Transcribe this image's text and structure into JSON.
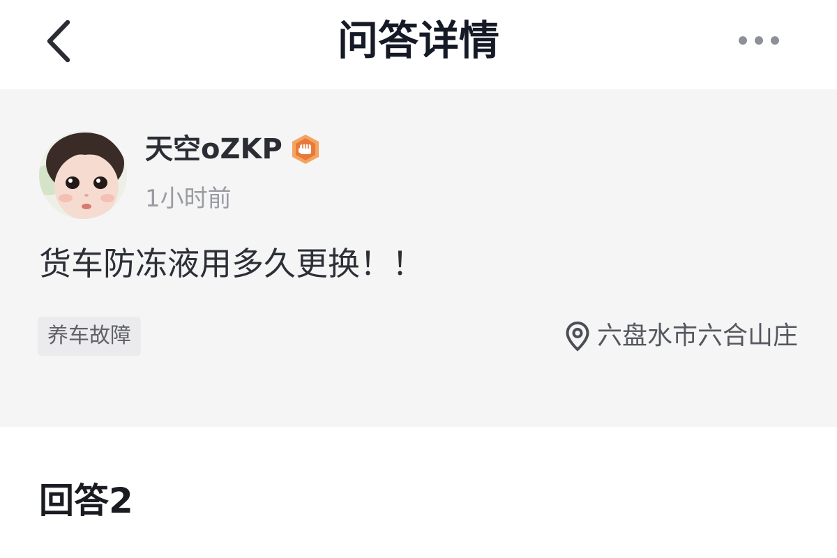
{
  "header": {
    "title": "问答详情",
    "back_icon": "chevron-left-icon",
    "more_icon": "more-horizontal-icon"
  },
  "question": {
    "author": {
      "name": "天空oZKP",
      "badge_icon": "fist-badge-icon",
      "badge_color": "#f08a3c",
      "avatar": "child-portrait-avatar"
    },
    "time": "1小时前",
    "text": "货车防冻液用多久更换！！",
    "tag": "养车故障",
    "location": {
      "icon": "map-pin-icon",
      "text": "六盘水市六合山庄"
    }
  },
  "answers": {
    "heading": "回答2"
  },
  "colors": {
    "card_background": "#f5f5f6",
    "title_text": "#151a26",
    "tag_background": "#ebebed"
  }
}
